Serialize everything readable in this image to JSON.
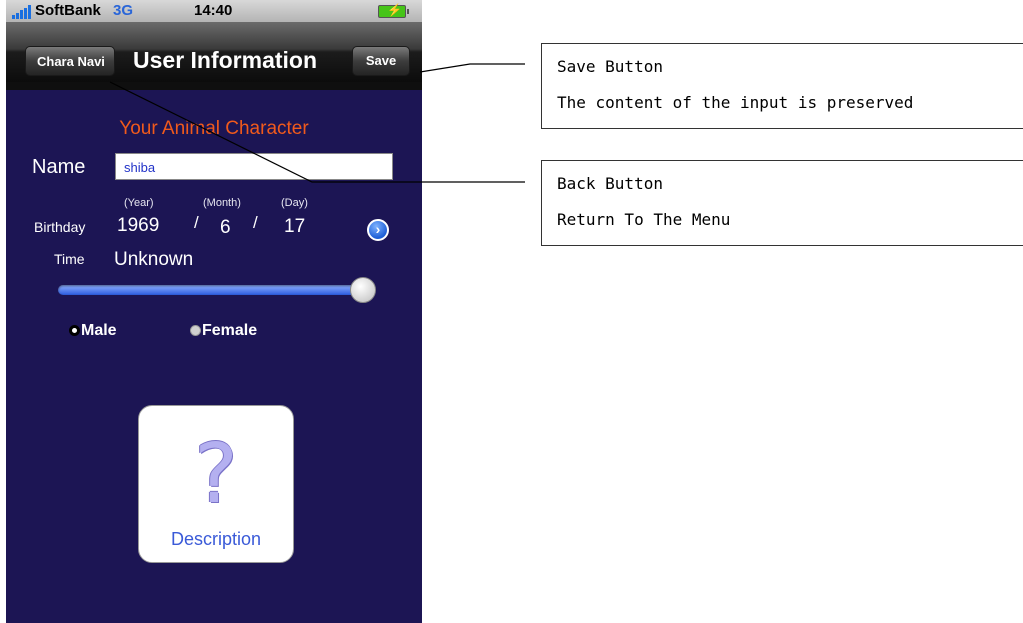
{
  "status_bar": {
    "carrier": "SoftBank",
    "network": "3G",
    "time": "14:40"
  },
  "nav": {
    "back_label": "Chara Navi",
    "title": "User Information",
    "save_label": "Save"
  },
  "form": {
    "section_title": "Your Animal Character",
    "name_label": "Name",
    "name_value": "shiba",
    "birthday_label": "Birthday",
    "year_caption": "(Year)",
    "month_caption": "(Month)",
    "day_caption": "(Day)",
    "year": "1969",
    "month": "6",
    "day": "17",
    "separator": "/",
    "time_label": "Time",
    "time_value": "Unknown",
    "time_slider_fraction": 1.0,
    "gender_options": [
      {
        "label": "Male",
        "selected": true
      },
      {
        "label": "Female",
        "selected": false
      }
    ],
    "description_label": "Description",
    "description_icon": "question-mark-icon"
  },
  "annotations": [
    {
      "title": "Save Button",
      "text": "The content of the input is preserved"
    },
    {
      "title": "Back Button",
      "text": "Return To The Menu"
    }
  ],
  "colors": {
    "background": "#1c1554",
    "accent": "#f05a1c",
    "link": "#3a5ad8"
  }
}
